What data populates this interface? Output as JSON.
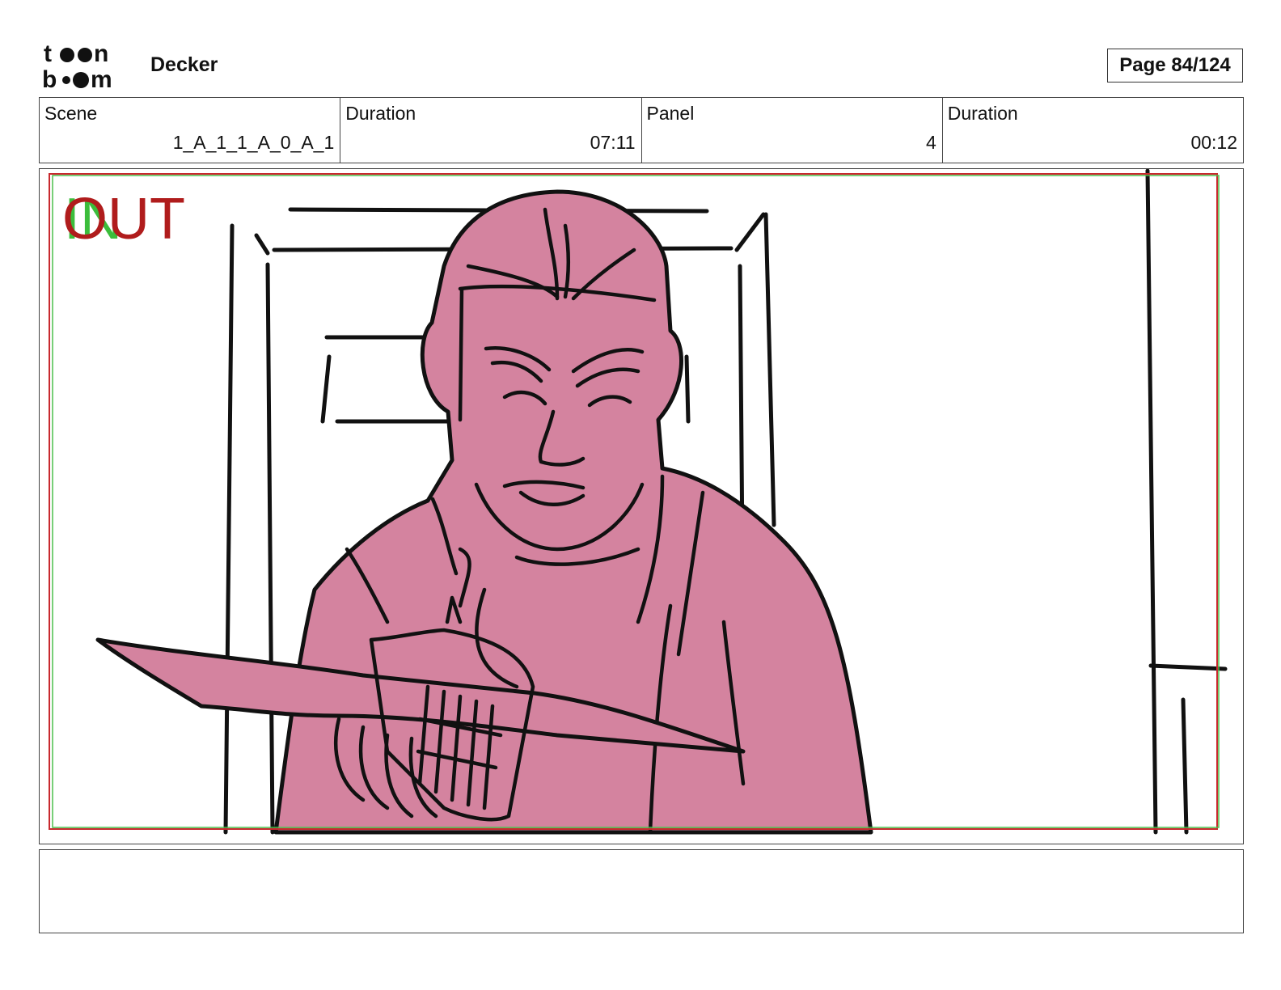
{
  "header": {
    "logo_text": "toon boom",
    "project_title": "Decker",
    "page_label": "Page",
    "page_number": "84/124"
  },
  "info": {
    "scene_label": "Scene",
    "scene_value": "1_A_1_1_A_0_A_1",
    "scene_duration_label": "Duration",
    "scene_duration_value": "07:11",
    "panel_label": "Panel",
    "panel_value": "4",
    "panel_duration_label": "Duration",
    "panel_duration_value": "00:12"
  },
  "panel": {
    "in_marker": "IN",
    "out_marker": "OUT",
    "fill_color": "#d4839f",
    "safe_frame_color": "#c8292e",
    "in_guide_color": "#4cbf4c"
  },
  "notes": {
    "text": ""
  }
}
